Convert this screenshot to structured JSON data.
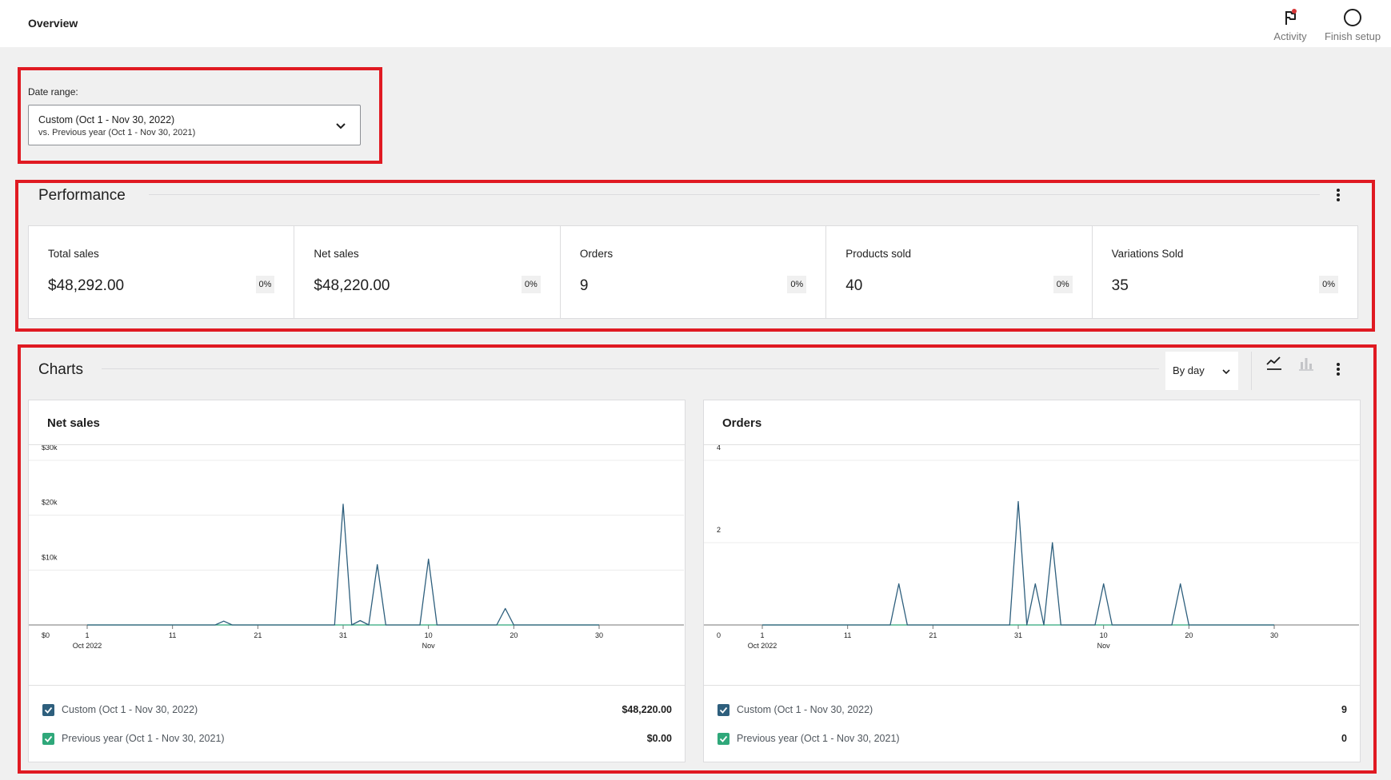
{
  "header": {
    "title": "Overview",
    "activity_label": "Activity",
    "finish_setup_label": "Finish setup"
  },
  "date_range": {
    "label": "Date range:",
    "primary": "Custom (Oct 1 - Nov 30, 2022)",
    "secondary": "vs. Previous year (Oct 1 - Nov 30, 2021)"
  },
  "performance": {
    "title": "Performance",
    "stats": [
      {
        "label": "Total sales",
        "value": "$48,292.00",
        "delta": "0%"
      },
      {
        "label": "Net sales",
        "value": "$48,220.00",
        "delta": "0%"
      },
      {
        "label": "Orders",
        "value": "9",
        "delta": "0%"
      },
      {
        "label": "Products sold",
        "value": "40",
        "delta": "0%"
      },
      {
        "label": "Variations Sold",
        "value": "35",
        "delta": "0%"
      }
    ]
  },
  "charts_section": {
    "title": "Charts",
    "interval": "By day"
  },
  "colors": {
    "current": "#2e5f7d",
    "previous": "#2fa87a",
    "highlight": "#e01a22"
  },
  "chart_data": [
    {
      "type": "line",
      "title": "Net sales",
      "x_ticks": [
        "1",
        "11",
        "21",
        "31",
        "10",
        "20",
        "30"
      ],
      "x_subticks": [
        "Oct 2022",
        "",
        "",
        "",
        "Nov",
        "",
        ""
      ],
      "y_ticks": [
        "$0",
        "$10k",
        "$20k",
        "$30k"
      ],
      "ylim": [
        0,
        30000
      ],
      "series": [
        {
          "name": "Custom (Oct 1 - Nov 30, 2022)",
          "total": "$48,220.00",
          "values": [
            0,
            0,
            0,
            0,
            0,
            0,
            0,
            0,
            0,
            0,
            0,
            0,
            0,
            0,
            0,
            0,
            700,
            0,
            0,
            0,
            0,
            0,
            0,
            0,
            0,
            0,
            0,
            0,
            0,
            0,
            22000,
            0,
            800,
            0,
            11000,
            0,
            0,
            0,
            0,
            0,
            12000,
            0,
            0,
            0,
            0,
            0,
            0,
            0,
            0,
            3000,
            0,
            0,
            0,
            0,
            0,
            0,
            0,
            0,
            0,
            0,
            0
          ]
        },
        {
          "name": "Previous year (Oct 1 - Nov 30, 2021)",
          "total": "$0.00",
          "values": [
            0,
            0,
            0,
            0,
            0,
            0,
            0,
            0,
            0,
            0,
            0,
            0,
            0,
            0,
            0,
            0,
            0,
            0,
            0,
            0,
            0,
            0,
            0,
            0,
            0,
            0,
            0,
            0,
            0,
            0,
            0,
            0,
            0,
            0,
            0,
            0,
            0,
            0,
            0,
            0,
            0,
            0,
            0,
            0,
            0,
            0,
            0,
            0,
            0,
            0,
            0,
            0,
            0,
            0,
            0,
            0,
            0,
            0,
            0,
            0,
            0
          ]
        }
      ]
    },
    {
      "type": "line",
      "title": "Orders",
      "x_ticks": [
        "1",
        "11",
        "21",
        "31",
        "10",
        "20",
        "30"
      ],
      "x_subticks": [
        "Oct 2022",
        "",
        "",
        "",
        "Nov",
        "",
        ""
      ],
      "y_ticks": [
        "0",
        "2",
        "4"
      ],
      "ylim": [
        0,
        4
      ],
      "series": [
        {
          "name": "Custom (Oct 1 - Nov 30, 2022)",
          "total": "9",
          "values": [
            0,
            0,
            0,
            0,
            0,
            0,
            0,
            0,
            0,
            0,
            0,
            0,
            0,
            0,
            0,
            0,
            1,
            0,
            0,
            0,
            0,
            0,
            0,
            0,
            0,
            0,
            0,
            0,
            0,
            0,
            3,
            0,
            1,
            0,
            2,
            0,
            0,
            0,
            0,
            0,
            1,
            0,
            0,
            0,
            0,
            0,
            0,
            0,
            0,
            1,
            0,
            0,
            0,
            0,
            0,
            0,
            0,
            0,
            0,
            0,
            0
          ]
        },
        {
          "name": "Previous year (Oct 1 - Nov 30, 2021)",
          "total": "0",
          "values": [
            0,
            0,
            0,
            0,
            0,
            0,
            0,
            0,
            0,
            0,
            0,
            0,
            0,
            0,
            0,
            0,
            0,
            0,
            0,
            0,
            0,
            0,
            0,
            0,
            0,
            0,
            0,
            0,
            0,
            0,
            0,
            0,
            0,
            0,
            0,
            0,
            0,
            0,
            0,
            0,
            0,
            0,
            0,
            0,
            0,
            0,
            0,
            0,
            0,
            0,
            0,
            0,
            0,
            0,
            0,
            0,
            0,
            0,
            0,
            0,
            0
          ]
        }
      ]
    }
  ]
}
